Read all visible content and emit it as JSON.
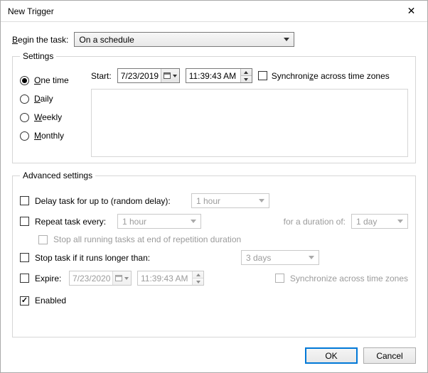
{
  "window": {
    "title": "New Trigger",
    "close": "✕"
  },
  "begin": {
    "label_left": "B",
    "label_right": "egin the task:",
    "value": "On a schedule"
  },
  "settings": {
    "legend": "Settings",
    "freq": {
      "one_l": "O",
      "one_r": "ne time",
      "daily_l": "D",
      "daily_r": "aily",
      "weekly_l": "W",
      "weekly_r": "eekly",
      "monthly_l": "M",
      "monthly_r": "onthly"
    },
    "start_label": "Start:",
    "start_date": "7/23/2019",
    "start_time": "11:39:43 AM",
    "sync_l": "Synchroni",
    "sync_u": "z",
    "sync_r": "e across time zones"
  },
  "advanced": {
    "legend": "Advanced settings",
    "delay_label": "Delay task for up to (random delay):",
    "delay_value": "1 hour",
    "repeat_label": "Repeat task every:",
    "repeat_value": "1 hour",
    "duration_label": "for a duration of:",
    "duration_value": "1 day",
    "stopend_label": "Stop all running tasks at end of repetition duration",
    "stopif_label": "Stop task if it runs longer than:",
    "stopif_value": "3 days",
    "expire_label": "Expire:",
    "expire_date": "7/23/2020",
    "expire_time": "11:39:43 AM",
    "sync2_label": "Synchronize across time zones",
    "enabled_label": "Enabled"
  },
  "buttons": {
    "ok": "OK",
    "cancel": "Cancel"
  }
}
